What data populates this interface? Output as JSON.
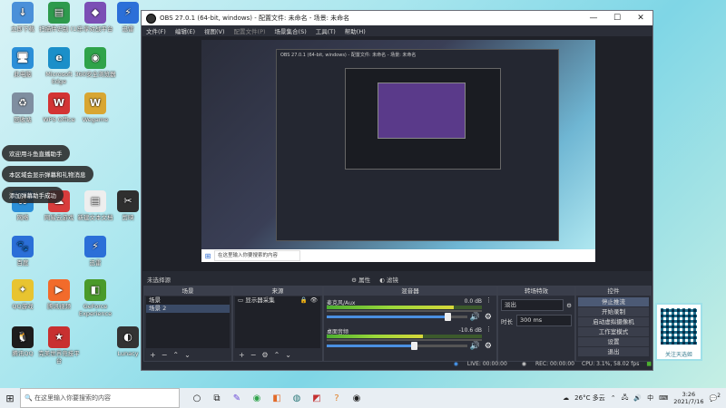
{
  "desktop_icons": [
    {
      "label": "立即下载",
      "color": "#4a90d9",
      "glyph": "↓"
    },
    {
      "label": "扫描件识别 (1)",
      "color": "#2e9a4d",
      "glyph": "▤"
    },
    {
      "label": "乐享对战平台",
      "color": "#7b4fb5",
      "glyph": "◆"
    },
    {
      "label": "迅雷",
      "color": "#2b6fd8",
      "glyph": "⚡"
    },
    {
      "label": "此电脑",
      "color": "#2b8fd8",
      "glyph": "🖥"
    },
    {
      "label": "Microsoft Edge",
      "color": "#1b8fc9",
      "glyph": "e"
    },
    {
      "label": "360安全浏览器",
      "color": "#2fa34a",
      "glyph": "◉"
    },
    {
      "label": "回收站",
      "color": "#7f8ea0",
      "glyph": "♻"
    },
    {
      "label": "WPS Office",
      "color": "#d33434",
      "glyph": "W"
    },
    {
      "label": "Wegame",
      "color": "#d8a632",
      "glyph": "W"
    },
    {
      "label": "网络",
      "color": "#2b8fd8",
      "glyph": "⌘"
    },
    {
      "label": "网易云游戏",
      "color": "#d83c3c",
      "glyph": "☁"
    },
    {
      "label": "新建文本文档",
      "color": "#eeeeee",
      "glyph": "▤"
    },
    {
      "label": "剪映",
      "color": "#2f2f2f",
      "glyph": "✂"
    },
    {
      "label": "百度",
      "color": "#2b6fd8",
      "glyph": "🐾"
    },
    {
      "label": "迅雷",
      "color": "#2b6fd8",
      "glyph": "⚡"
    },
    {
      "label": "QQ游戏",
      "color": "#e8c430",
      "glyph": "✦"
    },
    {
      "label": "腾讯视频",
      "color": "#f26b2b",
      "glyph": "▶"
    },
    {
      "label": "GeForce Experience",
      "color": "#4a9a2a",
      "glyph": "◧"
    },
    {
      "label": "腾讯QQ",
      "color": "#1d1d1d",
      "glyph": "🐧"
    },
    {
      "label": "完美世界竞技平台",
      "color": "#c83030",
      "glyph": "★"
    },
    {
      "label": "Lunacy",
      "color": "#333333",
      "glyph": "◐"
    }
  ],
  "toasts": [
    "欢迎用斗鱼直播助手",
    "本区域会显示弹幕和礼物消息",
    "添加弹幕助手成功"
  ],
  "obs": {
    "title": "OBS 27.0.1 (64-bit, windows) - 配置文件: 未命名 - 场景: 未命名",
    "menu": [
      "文件(F)",
      "编辑(E)",
      "视图(V)",
      "配置文件(P)",
      "场景集合(S)",
      "工具(T)",
      "帮助(H)"
    ],
    "nested_label": "OBS 27.0.1 (64-bit, windows) - 配置文件: 未命名 - 场景: 未命名",
    "preview_search": "在这里输入你要搜索的内容",
    "status_selection": "未选择源",
    "props_button": "属性",
    "filters_button": "滤镜",
    "docks": {
      "scenes": {
        "title": "场景",
        "items": [
          "场景",
          "场景 2"
        ]
      },
      "sources": {
        "title": "来源",
        "items": [
          "显示器采集"
        ]
      },
      "mixer": {
        "title": "混音器",
        "channels": [
          {
            "name": "麦克风/Aux",
            "db": "0.0 dB",
            "level": 0.82,
            "volume": 0.86
          },
          {
            "name": "桌面音频",
            "db": "-10.6 dB",
            "level": 0.62,
            "volume": 0.62
          }
        ]
      },
      "transitions": {
        "title": "转场特效",
        "type": "淡出",
        "duration_label": "时长",
        "duration": "300 ms"
      },
      "controls": {
        "title": "控件",
        "buttons": [
          "停止推流",
          "开始录制",
          "启动虚拟摄像机",
          "工作室模式",
          "设置",
          "退出"
        ]
      }
    },
    "status": {
      "live": "LIVE: 00:00:00",
      "rec": "REC: 00:00:00",
      "cpu": "CPU: 3.1%, 58.02 fps"
    }
  },
  "qr_caption": "关注天选姬",
  "taskbar": {
    "search_placeholder": "在这里输入你要搜索的内容",
    "weather": "26°C 多云",
    "ime": "中",
    "time": "3:26",
    "date": "2021/7/16",
    "notify_count": "2"
  }
}
